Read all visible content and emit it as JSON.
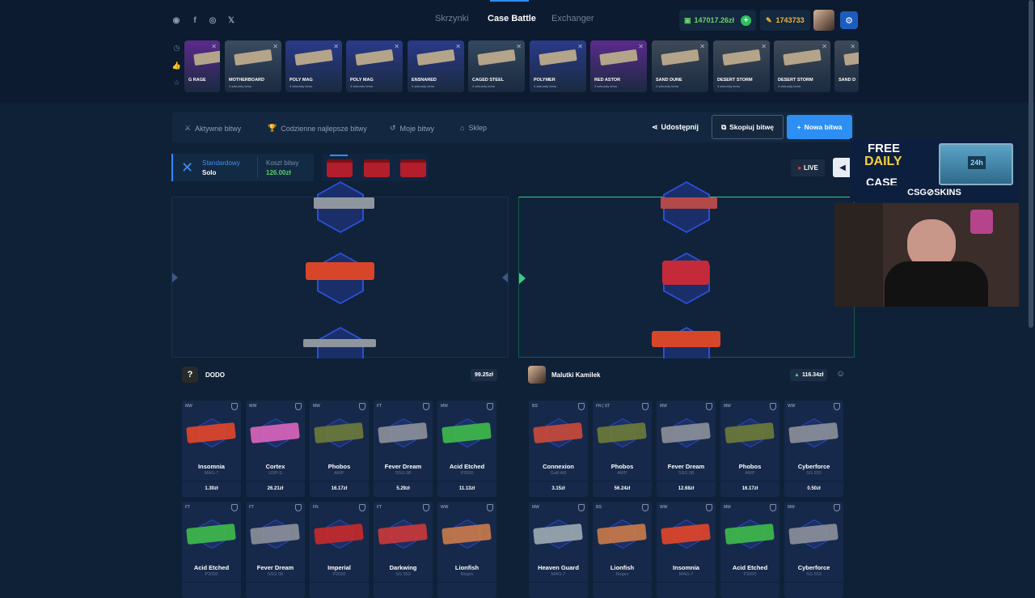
{
  "header": {
    "social": [
      "discord-icon",
      "facebook-icon",
      "instagram-icon",
      "x-icon"
    ],
    "nav": [
      {
        "label": "Skrzynki",
        "active": false
      },
      {
        "label": "Case Battle",
        "active": true
      },
      {
        "label": "Exchanger",
        "active": false
      }
    ],
    "balance": "147017.26zł",
    "coins": "1743733"
  },
  "recent_drops": [
    {
      "name": "G RAGE",
      "sub": "",
      "bg": "#5b2a8c"
    },
    {
      "name": "MOTHERBOARD",
      "sub": "4 sekundy temu",
      "bg": "#3a4b61"
    },
    {
      "name": "POLY MAG",
      "sub": "3 sekundy temu",
      "bg": "#2a3a8a"
    },
    {
      "name": "POLY MAG",
      "sub": "3 sekundy temu",
      "bg": "#2a3a8a"
    },
    {
      "name": "ENSNARED",
      "sub": "4 sekundy temu",
      "bg": "#2a3a8a"
    },
    {
      "name": "CAGED STEEL",
      "sub": "4 sekundy temu",
      "bg": "#33485e"
    },
    {
      "name": "POLYMER",
      "sub": "4 sekundy temu",
      "bg": "#2a3a8a"
    },
    {
      "name": "RED ASTOR",
      "sub": "3 sekundy temu",
      "bg": "#5b2a8c"
    },
    {
      "name": "SAND DUNE",
      "sub": "4 sekundy temu",
      "bg": "#3e4a58"
    },
    {
      "name": "DESERT STORM",
      "sub": "4 sekundy temu",
      "bg": "#3e4a58"
    },
    {
      "name": "DESERT STORM",
      "sub": "4 sekundy temu",
      "bg": "#3e4a58"
    },
    {
      "name": "SAND D",
      "sub": "",
      "bg": "#3e4a58"
    }
  ],
  "filters": {
    "tabs": [
      "Aktywne bitwy",
      "Codzienne najlepsze bitwy",
      "Moje bitwy",
      "Sklep"
    ],
    "share": "Udostępnij",
    "copy": "Skopiuj bitwę",
    "new": "Nowa bitwa"
  },
  "battle": {
    "mode": "Standardowy",
    "mode_sub": "Solo",
    "cost_label": "Koszt bitwy",
    "cost": "126.00zł",
    "live": "LIVE"
  },
  "players": [
    {
      "name": "DODO",
      "value": "99.25zł",
      "items": [
        {
          "cond": "MW",
          "name": "Insomnia",
          "weapon": "MAG-7",
          "price": "1.30zł",
          "color": "#e0452a"
        },
        {
          "cond": "WW",
          "name": "Cortex",
          "weapon": "USP-S",
          "price": "26.21zł",
          "color": "#d864b8"
        },
        {
          "cond": "MW",
          "name": "Phobos",
          "weapon": "AWP",
          "price": "16.17zł",
          "color": "#6b7a3a"
        },
        {
          "cond": "FT",
          "name": "Fever Dream",
          "weapon": "SSG 08",
          "price": "5.29zł",
          "color": "#8a8f98"
        },
        {
          "cond": "MW",
          "name": "Acid Etched",
          "weapon": "P2000",
          "price": "11.13zł",
          "color": "#3fb84a"
        },
        {
          "cond": "FT",
          "name": "Acid Etched",
          "weapon": "P2000",
          "price": "",
          "color": "#3fb84a"
        },
        {
          "cond": "FT",
          "name": "Fever Dream",
          "weapon": "SSG 08",
          "price": "",
          "color": "#8a8f98"
        },
        {
          "cond": "FN",
          "name": "Imperial",
          "weapon": "P2000",
          "price": "",
          "color": "#c42a2a"
        },
        {
          "cond": "FT",
          "name": "Darkwing",
          "weapon": "SG 553",
          "price": "",
          "color": "#c83a3a"
        },
        {
          "cond": "WW",
          "name": "Lionfish",
          "weapon": "Negev",
          "price": "",
          "color": "#c87a4a"
        }
      ]
    },
    {
      "name": "Malutki Kamilek",
      "value": "116.34zł",
      "items": [
        {
          "cond": "BS",
          "name": "Connexion",
          "weapon": "Galil AR",
          "price": "3.15zł",
          "color": "#c84a3a"
        },
        {
          "cond": "FN | ST",
          "name": "Phobos",
          "weapon": "AWP",
          "price": "56.24zł",
          "color": "#6b7a3a"
        },
        {
          "cond": "MW",
          "name": "Fever Dream",
          "weapon": "SSG 08",
          "price": "12.68zł",
          "color": "#8a8f98"
        },
        {
          "cond": "MW",
          "name": "Phobos",
          "weapon": "AWP",
          "price": "16.17zł",
          "color": "#6b7a3a"
        },
        {
          "cond": "WW",
          "name": "Cyberforce",
          "weapon": "SG 553",
          "price": "0.50zł",
          "color": "#8a8f98"
        },
        {
          "cond": "MW",
          "name": "Heaven Guard",
          "weapon": "MAG-7",
          "price": "",
          "color": "#9aa8b0"
        },
        {
          "cond": "BS",
          "name": "Lionfish",
          "weapon": "Negev",
          "price": "",
          "color": "#c87a4a"
        },
        {
          "cond": "WW",
          "name": "Insomnia",
          "weapon": "MAG-7",
          "price": "",
          "color": "#e0452a"
        },
        {
          "cond": "MW",
          "name": "Acid Etched",
          "weapon": "P2000",
          "price": "",
          "color": "#3fb84a"
        },
        {
          "cond": "MW",
          "name": "Cyberforce",
          "weapon": "SG 553",
          "price": "",
          "color": "#8a8f98"
        }
      ]
    }
  ],
  "ad": {
    "line1": "FREE",
    "line2": "DAILY",
    "line3": "CASE",
    "brand": "CSG⊘SKINS",
    "badge": "24h"
  }
}
